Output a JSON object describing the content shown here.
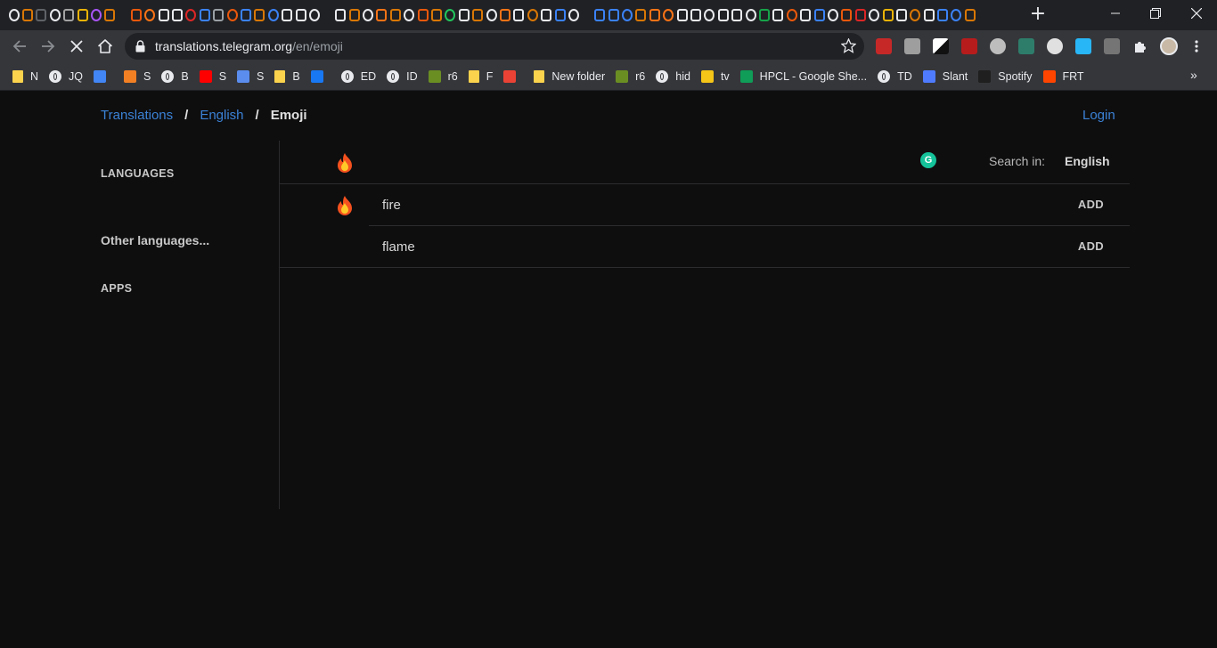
{
  "browser": {
    "url_host": "translations.telegram.org",
    "url_path": "/en/emoji",
    "tab_icon_colors": [
      "#e8eaed",
      "#d97706",
      "#5f6368",
      "#e8eaed",
      "#a3a3a3",
      "#eab308",
      "#a855f7",
      "#d97706",
      "#ea580c",
      "#f97316",
      "#e8eaed",
      "#e8eaed",
      "#dc2626",
      "#3b82f6",
      "#9aa0a6",
      "#ea580c",
      "#3b82f6",
      "#d97706",
      "#3b82f6",
      "#e8eaed",
      "#e8eaed",
      "#e8eaed",
      "#e8eaed",
      "#d97706",
      "#e8eaed",
      "#f97316",
      "#d97706",
      "#e8eaed",
      "#ea580c",
      "#d97706",
      "#22c55e",
      "#e8eaed",
      "#d97706",
      "#e8eaed",
      "#f97316",
      "#e8eaed",
      "#d97706",
      "#e8eaed",
      "#3b82f6",
      "#e8eaed",
      "#3b82f6",
      "#3b82f6",
      "#3b82f6",
      "#d97706",
      "#f97316",
      "#f97316",
      "#e8eaed",
      "#e8eaed",
      "#e8eaed",
      "#e8eaed",
      "#e8eaed",
      "#e8eaed",
      "#16a34a",
      "#e8eaed",
      "#ea580c",
      "#e8eaed",
      "#3b82f6",
      "#e8eaed",
      "#ea580c",
      "#dc2626",
      "#e8eaed",
      "#eab308",
      "#e8eaed",
      "#d97706",
      "#e8eaed",
      "#3b82f6",
      "#3b82f6",
      "#d97706"
    ],
    "bookmarks": [
      {
        "label": "N",
        "icon": "folder-icon",
        "kind": "folder"
      },
      {
        "label": "JQ",
        "icon": "globe-icon",
        "kind": "globe"
      },
      {
        "label": "",
        "icon": "google-translate-icon",
        "kind": "color",
        "color": "#4285f4"
      },
      {
        "label": "S",
        "icon": "stackoverflow-icon",
        "kind": "color",
        "color": "#f48024"
      },
      {
        "label": "B",
        "icon": "globe-icon",
        "kind": "globe"
      },
      {
        "label": "S",
        "icon": "youtube-icon",
        "kind": "color",
        "color": "#ff0000"
      },
      {
        "label": "S",
        "icon": "wheel-icon",
        "kind": "color",
        "color": "#5b8def"
      },
      {
        "label": "B",
        "icon": "folder-icon",
        "kind": "folder"
      },
      {
        "label": "",
        "icon": "facebook-icon",
        "kind": "color",
        "color": "#1877f2"
      },
      {
        "label": "ED",
        "icon": "globe-icon",
        "kind": "globe"
      },
      {
        "label": "ID",
        "icon": "globe-icon",
        "kind": "globe"
      },
      {
        "label": "r6",
        "icon": "game-icon",
        "kind": "color",
        "color": "#6b8e23"
      },
      {
        "label": "F",
        "icon": "folder-icon",
        "kind": "folder"
      },
      {
        "label": "",
        "icon": "gmail-icon",
        "kind": "color",
        "color": "#ea4335"
      },
      {
        "label": "New folder",
        "icon": "folder-icon",
        "kind": "folder"
      },
      {
        "label": "r6",
        "icon": "game-icon",
        "kind": "color",
        "color": "#6b8e23"
      },
      {
        "label": "hid",
        "icon": "globe-icon",
        "kind": "globe"
      },
      {
        "label": "tv",
        "icon": "imdb-icon",
        "kind": "color",
        "color": "#f5c518"
      },
      {
        "label": "HPCL - Google She...",
        "icon": "google-sheets-icon",
        "kind": "color",
        "color": "#0f9d58"
      },
      {
        "label": "TD",
        "icon": "github-icon",
        "kind": "globe"
      },
      {
        "label": "Slant",
        "icon": "slant-icon",
        "kind": "color",
        "color": "#4f7cff"
      },
      {
        "label": "Spotify",
        "icon": "spotify-icon",
        "kind": "color",
        "color": "#1f1f1f"
      },
      {
        "label": "FRT",
        "icon": "reddit-icon",
        "kind": "color",
        "color": "#ff4500"
      }
    ]
  },
  "page": {
    "breadcrumb": {
      "root": "Translations",
      "lang": "English",
      "current": "Emoji",
      "separator": "/"
    },
    "login": "Login",
    "sidebar": {
      "languages": "LANGUAGES",
      "other_languages": "Other languages...",
      "apps": "APPS"
    },
    "search": {
      "label": "Search in:",
      "language": "English"
    },
    "results": [
      {
        "text": "fire",
        "action": "ADD"
      },
      {
        "text": "flame",
        "action": "ADD"
      }
    ]
  }
}
